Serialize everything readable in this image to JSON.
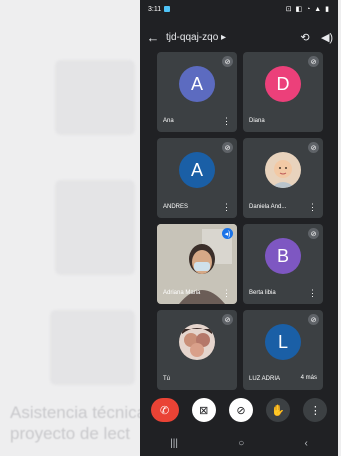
{
  "status_bar": {
    "time": "3:11",
    "icons": "⊡ ◧ ◔ ▲ ▮"
  },
  "meeting": {
    "code": "tjd-qqaj-zqo",
    "expand": "▸"
  },
  "participants": [
    {
      "name": "Ana",
      "initial": "A",
      "color": "#5c6bc0",
      "type": "initial"
    },
    {
      "name": "Diana",
      "initial": "D",
      "color": "#ec407a",
      "type": "initial"
    },
    {
      "name": "ANDRES",
      "initial": "A",
      "color": "#1a5fa6",
      "type": "initial"
    },
    {
      "name": "Daniela And...",
      "type": "photo",
      "color": "#f0c8a8"
    },
    {
      "name": "Adriana Maria",
      "type": "video"
    },
    {
      "name": "Berta libia",
      "initial": "B",
      "color": "#7e57c2",
      "type": "initial"
    },
    {
      "name": "Tú",
      "type": "photo",
      "color": "#c79a8a"
    },
    {
      "name": "LUZ ADRIA",
      "initial": "L",
      "color": "#1a5fa6",
      "type": "initial",
      "extra": "4 más"
    }
  ],
  "controls": [
    "end-call",
    "camera-off",
    "mic-off",
    "raise-hand",
    "more"
  ],
  "background_text": [
    "Asistencia técnica",
    "proyecto de lect"
  ]
}
